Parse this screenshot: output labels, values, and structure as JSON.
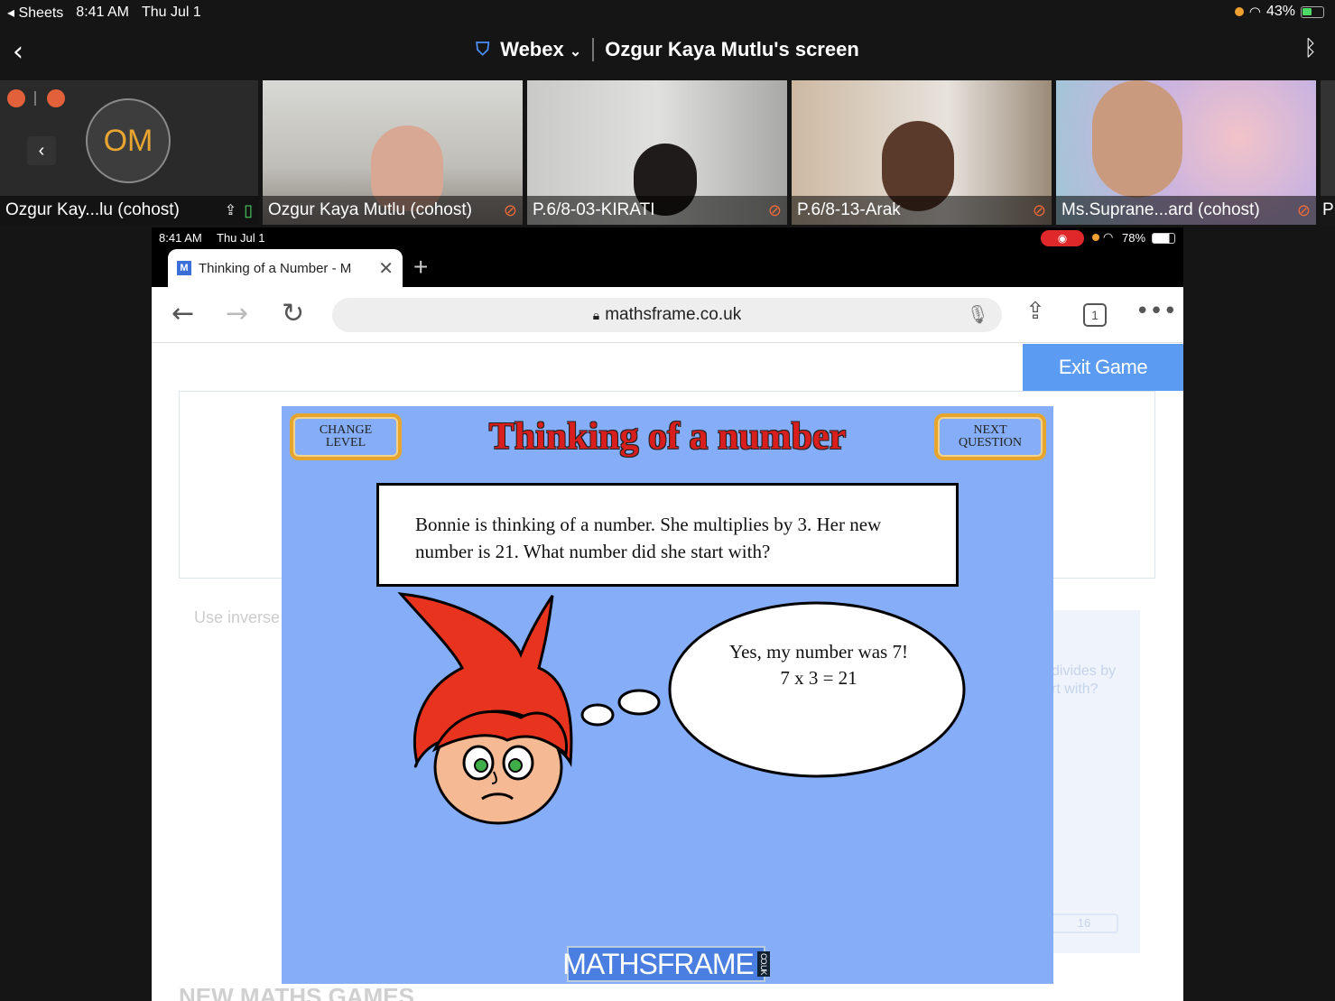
{
  "ios_status": {
    "back_app": "Sheets",
    "time": "8:41 AM",
    "date": "Thu Jul 1",
    "battery": "43%"
  },
  "header": {
    "app": "Webex",
    "screen_title": "Ozgur Kaya Mutlu's screen"
  },
  "participants": [
    {
      "name": "Ozgur Kay...lu (cohost)",
      "initials": "OM"
    },
    {
      "name": "Ozgur Kaya Mutlu (cohost)"
    },
    {
      "name": "P.6/8-03-KIRATI"
    },
    {
      "name": "P.6/8-13-Arak"
    },
    {
      "name": "Ms.Suprane...ard (cohost)"
    },
    {
      "name": "P"
    }
  ],
  "shared_screen": {
    "status": {
      "time": "8:41 AM",
      "date": "Thu Jul 1",
      "battery": "78%"
    },
    "tab": {
      "title": "Thinking of a Number - M",
      "favicon": "M"
    },
    "url": "mathsframe.co.uk",
    "tab_count": "1",
    "exit_label": "Exit Game",
    "bg_hint": "Use inverse o",
    "bg_panel_text": "divides by\nrt with?",
    "bg_panel_value": "16",
    "bg_heading": "NEW MATHS GAMES",
    "game": {
      "change_level": "CHANGE\nLEVEL",
      "next_question": "NEXT\nQUESTION",
      "title": "Thinking of a number",
      "question": "Bonnie is thinking of a number. She multiplies by 3. Her new number is 21. What number did she start with?",
      "answer_line1": "Yes, my number was 7!",
      "answer_line2": "7 x 3 = 21",
      "logo": "MATHSFRAME",
      "logo_suffix": "CO.UK"
    }
  }
}
